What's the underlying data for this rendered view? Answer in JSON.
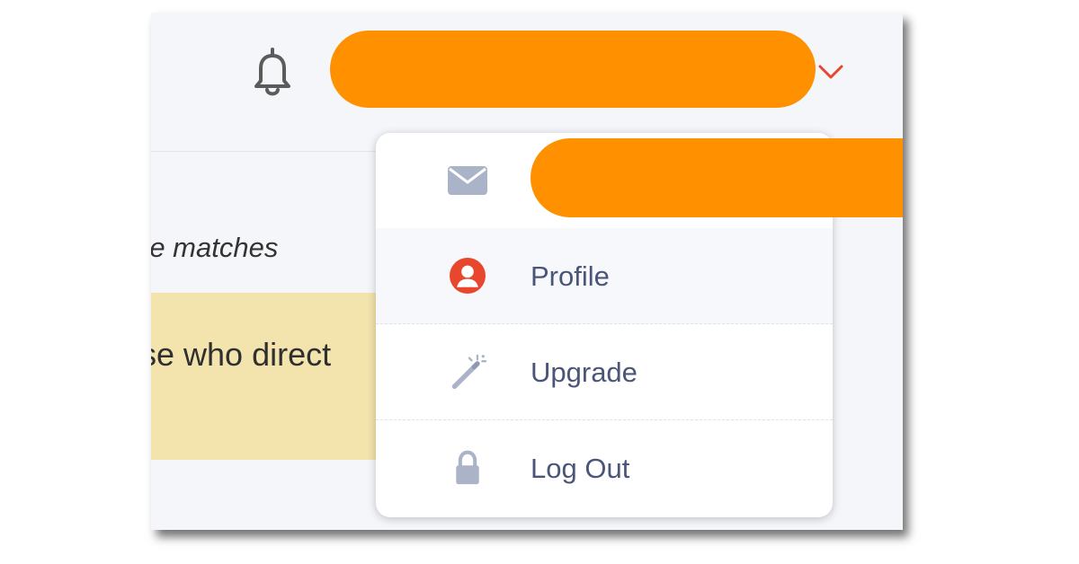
{
  "header": {
    "icons": {
      "notifications": "bell-icon",
      "account_menu": "chevron-down-icon"
    },
    "redaction_color": "#ff9100",
    "accent_color": "#e8462d"
  },
  "content": {
    "matches_text": "re matches",
    "highlight_text": "se who direct"
  },
  "menu": {
    "items": [
      {
        "icon": "envelope-icon",
        "label": ""
      },
      {
        "icon": "user-circle-icon",
        "label": "Profile"
      },
      {
        "icon": "magic-wand-icon",
        "label": "Upgrade"
      },
      {
        "icon": "lock-icon",
        "label": "Log Out"
      }
    ]
  }
}
